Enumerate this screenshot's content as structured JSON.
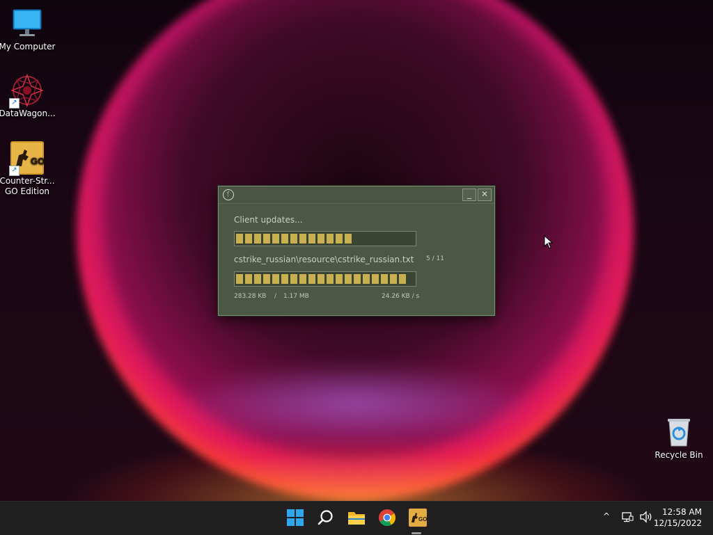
{
  "desktop": {
    "icons": [
      {
        "label": "My Computer"
      },
      {
        "label": "DataWagon..."
      },
      {
        "label": "Counter-Str... GO Edition"
      },
      {
        "label": "Recycle Bin"
      }
    ]
  },
  "updater": {
    "status": "Client updates...",
    "overall_progress": 0.63,
    "current_file": "cstrike_russian\\resource\\cstrike_russian.txt",
    "file_counter": "5 / 11",
    "file_progress": 0.95,
    "downloaded": "283.28 KB",
    "separator": "/",
    "total": "1.17 MB",
    "speed": "24.26 KB / s",
    "title_icon": "steam-logo-icon",
    "minimize_label": "_",
    "close_label": "✕"
  },
  "taskbar": {
    "apps": [
      "start-icon",
      "search-icon",
      "file-explorer-icon",
      "chrome-icon",
      "csgo-icon"
    ],
    "tray": {
      "chevron": "^"
    },
    "time": "12:58 AM",
    "date": "12/15/2022"
  },
  "colors": {
    "window_bg": "#4c5844",
    "progress_fill": "#c8b050",
    "taskbar_bg": "#202020"
  }
}
